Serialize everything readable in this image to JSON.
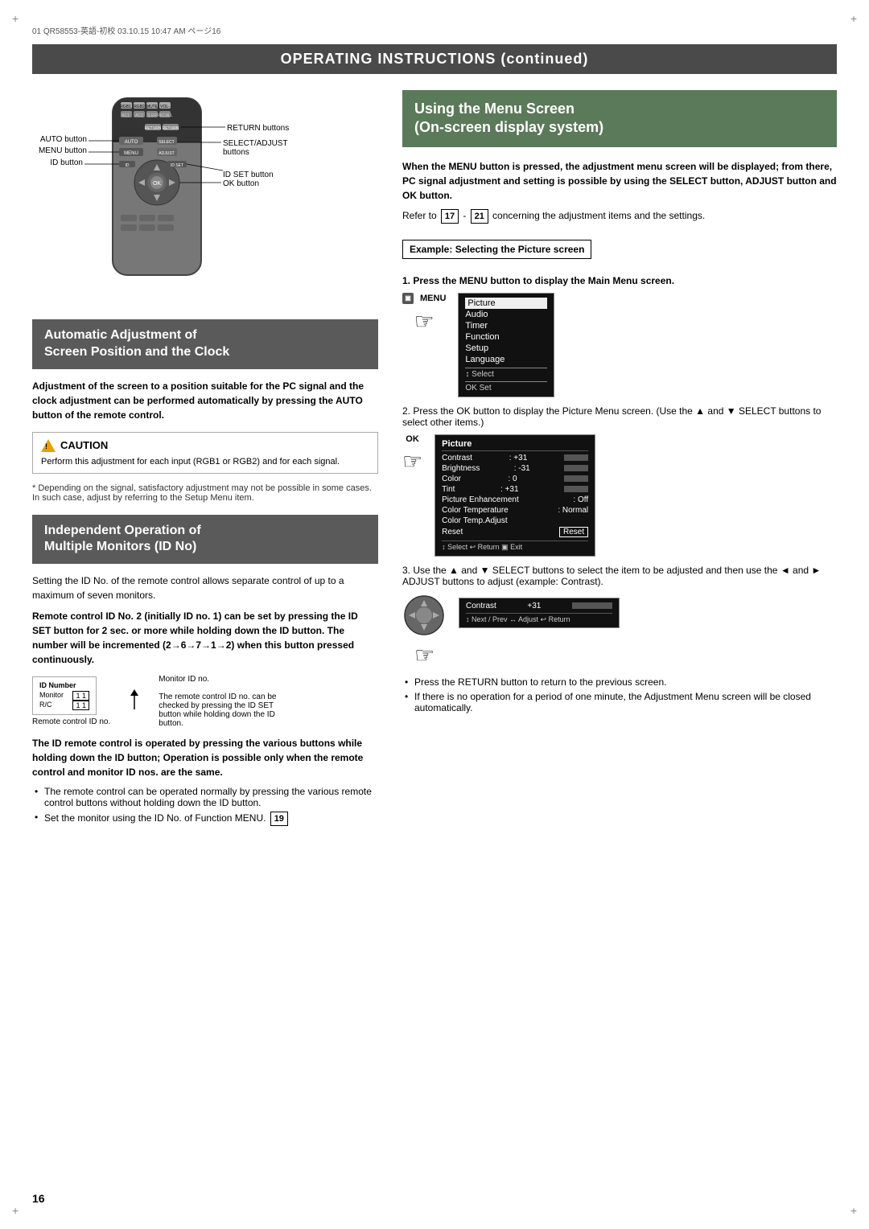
{
  "metadata": {
    "file_info": "01 QR58553-英語-初校  03.10.15  10:47 AM  ページ16"
  },
  "header": {
    "title": "OPERATING INSTRUCTIONS (continued)"
  },
  "left_column": {
    "auto_section": {
      "title_line1": "Automatic Adjustment of",
      "title_line2": "Screen Position and the Clock",
      "description": "Adjustment of the screen to a position suitable for the PC signal and the clock adjustment can be performed automatically by pressing the AUTO button of the remote control.",
      "caution_title": "CAUTION",
      "caution_text": "Perform this adjustment for each input (RGB1 or RGB2) and for each signal.",
      "note_text": "* Depending on the signal, satisfactory adjustment may not be possible in some cases. In such case, adjust by referring to the Setup Menu item."
    },
    "id_section": {
      "title_line1": "Independent Operation of",
      "title_line2": "Multiple Monitors (ID No)",
      "description1": "Setting the ID No. of the remote control allows separate control of up to a maximum of seven monitors.",
      "description2": "Remote control ID No. 2 (initially ID no. 1) can be set by pressing the ID SET button for 2 sec. or more while holding down the ID button.  The number will be incremented (2→6→7→1→2) when this button pressed continuously.",
      "id_box_label1": "ID Number",
      "id_box_label2": "Monitor",
      "id_box_label3": "R/C",
      "id_box_val1": "1 1",
      "id_box_val2": "1 1",
      "monitor_label": "Monitor ID no.",
      "remote_id_label": "Remote control ID no.",
      "id_note": "The remote control ID no. can be checked by pressing the ID SET button while holding down the ID button.",
      "footer1": "The ID remote control is operated by pressing the various buttons while holding down the ID button; Operation is possible only when the remote control and monitor ID nos. are the same.",
      "footer_bullet1": "The remote control can be operated normally by pressing the various remote control buttons without holding down the ID button.",
      "footer_bullet2": "Set the monitor using the ID No. of Function MENU.",
      "ref_number_19": "19"
    },
    "remote_labels": {
      "auto_button": "AUTO button",
      "menu_button": "MENU button",
      "id_button": "ID button",
      "return_buttons": "RETURN buttons",
      "select_adjust_buttons": "SELECT/ADJUST buttons",
      "ok_button": "OK button",
      "id_set_button": "ID SET button"
    }
  },
  "right_column": {
    "title_line1": "Using the Menu Screen",
    "title_line2": "(On-screen display system)",
    "intro_text": "When the MENU button is pressed, the adjustment menu screen will be displayed; from there, PC signal adjustment and setting is possible by using the SELECT button, ADJUST button and OK button.",
    "refer_text": "Refer to",
    "ref_num1": "17",
    "ref_num2": "21",
    "refer_text2": "concerning the adjustment items and the settings.",
    "example_label": "Example: Selecting the Picture screen",
    "step1_label": "1. Press the MENU button to display the Main Menu screen.",
    "menu_icon_label": "MENU",
    "menu_items": [
      "Picture",
      "Audio",
      "Timer",
      "Function",
      "Setup",
      "Language",
      "↕ Select",
      "OK  Set"
    ],
    "menu_active_item": "Picture",
    "step2_label": "2. Press the OK button to display the Picture Menu screen. (Use the ▲ and ▼ SELECT buttons to select other items.)",
    "picture_menu_title": "Picture",
    "picture_menu_items": [
      {
        "label": "Contrast",
        "value": ": +31"
      },
      {
        "label": "Brightness",
        "value": ": -31"
      },
      {
        "label": "Color",
        "value": ":  0"
      },
      {
        "label": "Tint",
        "value": ": +31"
      },
      {
        "label": "Picture Enhancement",
        "value": ": Off"
      },
      {
        "label": "Color Temperature",
        "value": ": Normal"
      },
      {
        "label": "Color Temp.Adjust",
        "value": ""
      },
      {
        "label": "Reset",
        "value": ""
      }
    ],
    "picture_menu_bottom": "↕ Select   ↩ Return   Exit",
    "step3_label": "3. Use the ▲ and ▼ SELECT buttons to select the item to be adjusted and then use the ◄ and ► ADJUST buttons to adjust (example: Contrast).",
    "contrast_bar_label": "Contrast",
    "contrast_value": "+31",
    "contrast_bottom": "↕ Next / Prev   ↔ Adjust   ↩ Return",
    "return_note": "Press the RETURN button to return to the previous screen.",
    "auto_close_note": "If there is no operation for a period of one minute, the Adjustment Menu screen will be closed automatically."
  },
  "page_number": "16"
}
